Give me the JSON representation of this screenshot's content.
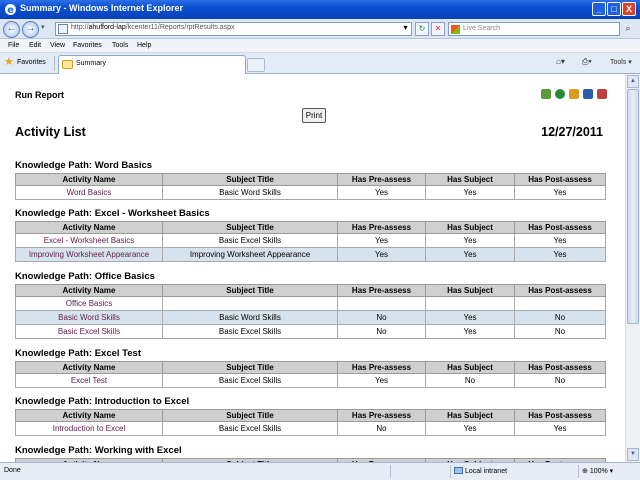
{
  "window": {
    "title": "Summary - Windows Internet Explorer",
    "min_label": "_",
    "max_label": "□",
    "close_label": "X"
  },
  "address": {
    "url_prefix": "http://",
    "url_host": "ahufford-lap",
    "url_path": "/kcenter11/Reports/rptResults.aspx",
    "search_placeholder": "Live Search",
    "back_glyph": "←",
    "forward_glyph": "→",
    "refresh_glyph": "↻",
    "stop_glyph": "✕"
  },
  "menu": [
    "File",
    "Edit",
    "View",
    "Favorites",
    "Tools",
    "Help"
  ],
  "tabs": {
    "favorites_label": "Favorites",
    "active_tab_label": "Summary",
    "tools_label": "Tools"
  },
  "report": {
    "run_report_label": "Run Report",
    "print_label": "Print",
    "title": "Activity List",
    "date": "12/27/2011",
    "columns": [
      "Activity Name",
      "Subject Title",
      "Has Pre-assess",
      "Has Subject",
      "Has Post-assess"
    ],
    "paths": [
      {
        "title": "Knowledge Path: Word Basics",
        "rows": [
          [
            "Word Basics",
            "Basic Word Skills",
            "Yes",
            "Yes",
            "Yes"
          ]
        ]
      },
      {
        "title": "Knowledge Path: Excel - Worksheet Basics",
        "rows": [
          [
            "Excel - Worksheet Basics",
            "Basic Excel Skills",
            "Yes",
            "Yes",
            "Yes"
          ],
          [
            "Improving Worksheet Appearance",
            "Improving Worksheet Appearance",
            "Yes",
            "Yes",
            "Yes"
          ]
        ]
      },
      {
        "title": "Knowledge Path: Office Basics",
        "rows": [
          [
            "Office Basics",
            "",
            "",
            "",
            ""
          ],
          [
            "Basic Word Skills",
            "Basic Word Skills",
            "No",
            "Yes",
            "No"
          ],
          [
            "Basic Excel Skills",
            "Basic Excel Skills",
            "No",
            "Yes",
            "No"
          ]
        ]
      },
      {
        "title": "Knowledge Path: Excel Test",
        "rows": [
          [
            "Excel Test",
            "Basic Excel Skills",
            "Yes",
            "No",
            "No"
          ]
        ]
      },
      {
        "title": "Knowledge Path: Introduction to Excel",
        "rows": [
          [
            "Introduction to Excel",
            "Basic Excel Skills",
            "No",
            "Yes",
            "Yes"
          ]
        ]
      },
      {
        "title": "Knowledge Path: Working with Excel",
        "rows": []
      }
    ]
  },
  "status": {
    "text": "Done",
    "zone": "Local intranet",
    "zoom": "100%"
  },
  "colors": {
    "titlebar": "#0b4ed0",
    "alt_row": "#d6e3ec",
    "header_row": "#cfcfcf",
    "link_text": "#62204c"
  }
}
